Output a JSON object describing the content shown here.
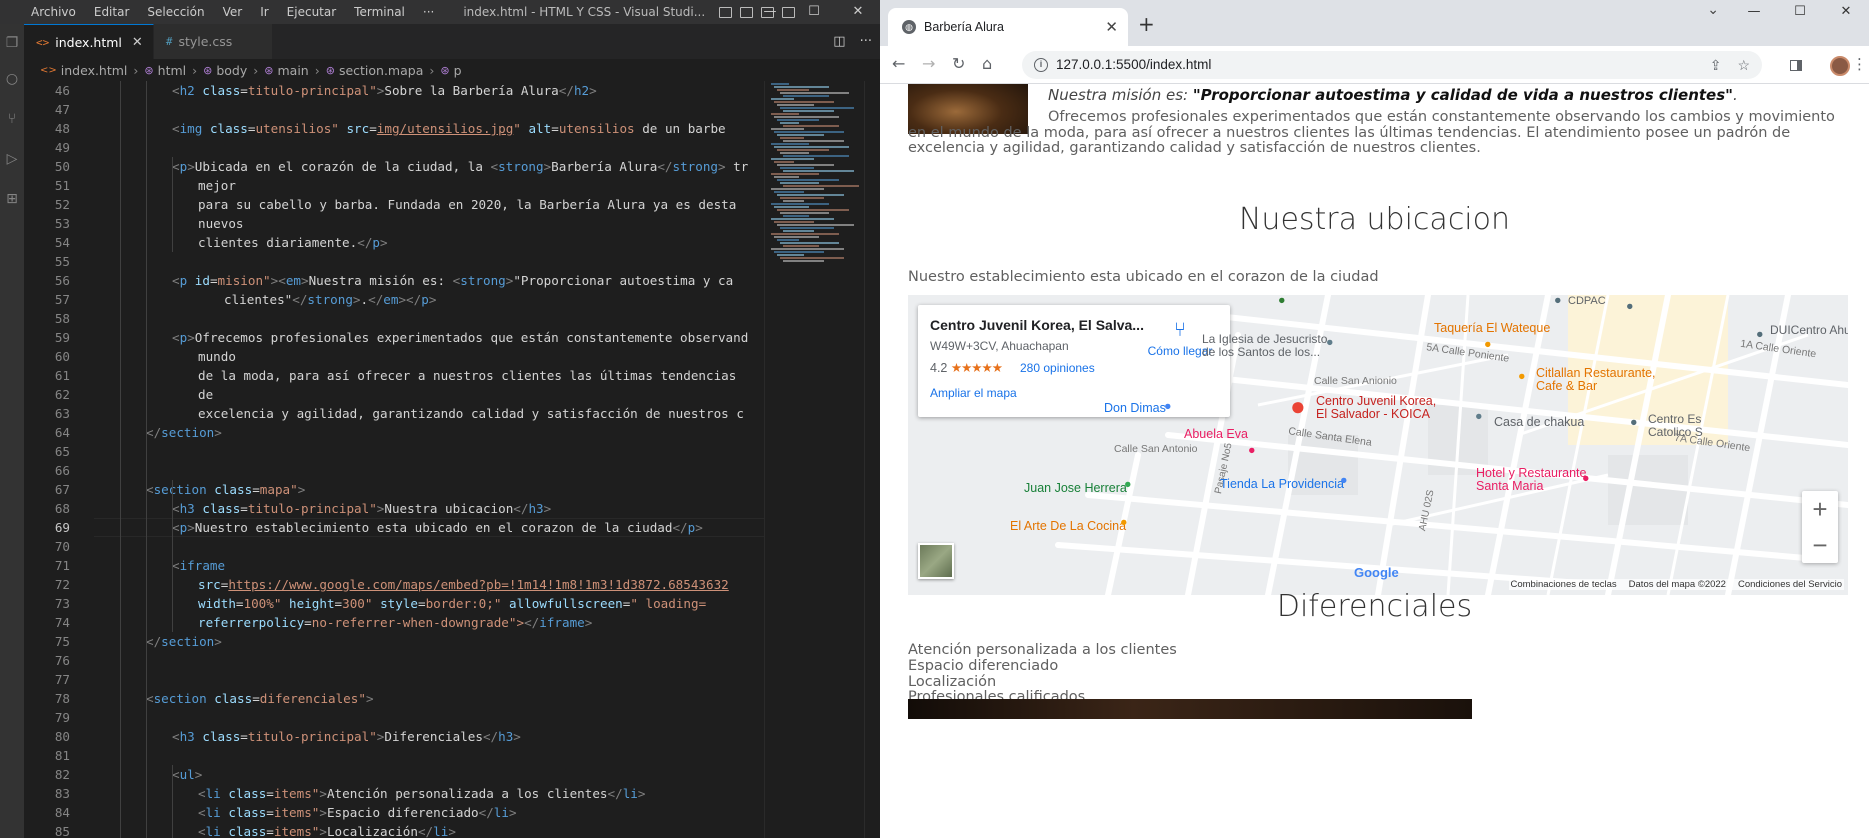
{
  "vscode": {
    "menu": [
      "Archivo",
      "Editar",
      "Selección",
      "Ver",
      "Ir",
      "Ejecutar",
      "Terminal",
      "···"
    ],
    "window_title": "index.html - HTML Y CSS - Visual Studi...",
    "tabs": [
      {
        "label": "index.html",
        "icon": "html-icon",
        "active": true
      },
      {
        "label": "style.css",
        "icon": "css-icon",
        "active": false
      }
    ],
    "breadcrumb": [
      "index.html",
      "html",
      "body",
      "main",
      "section.mapa",
      "p"
    ],
    "current_line": 69,
    "line_numbers": [
      "46",
      "47",
      "48",
      "49",
      "50",
      "51",
      "52",
      "53",
      "54",
      "55",
      "56",
      "57",
      "58",
      "59",
      "60",
      "61",
      "62",
      "63",
      "64",
      "65",
      "66",
      "67",
      "68",
      "69",
      "70",
      "71",
      "72",
      "73",
      "74",
      "75",
      "76",
      "77",
      "78",
      "79",
      "80",
      "81",
      "82",
      "83",
      "84",
      "85"
    ],
    "code": [
      "<h2 class=\"titulo-principal\">Sobre la Barbería Alura</h2>",
      "",
      "<img class=\"utensilios\" src=\"img/utensilios.jpg\" alt=\"utensilios de un barbe",
      "",
      "<p>Ubicada en el corazón de la ciudad, la <strong>Barbería Alura</strong> tr",
      "mejor",
      "para su cabello y barba. Fundada en 2020, la Barbería Alura ya es desta",
      "nuevos",
      "clientes diariamente.</p>",
      "",
      "<p id=\"mision\"><em>Nuestra misión es: <strong>\"Proporcionar autoestima y ca",
      "clientes\"</strong>.</em></p>",
      "",
      "<p>Ofrecemos profesionales experimentados que están constantemente observand",
      "mundo",
      "de la moda, para así ofrecer a nuestros clientes las últimas tendencias",
      "de",
      "excelencia y agilidad, garantizando calidad y satisfacción de nuestros c",
      "</section>",
      "",
      "",
      "<section class=\"mapa\">",
      "<h3 class=\"titulo-principal\">Nuestra ubicacion</h3>",
      "<p>Nuestro establecimiento esta ubicado en el corazon de la ciudad</p>",
      "",
      "<iframe",
      "src=\"https://www.google.com/maps/embed?pb=!1m14!1m8!1m3!1d3872.68543632",
      "width=\"100%\" height=\"300\" style=\"border:0;\" allowfullscreen=\"\" loading=",
      "referrerpolicy=\"no-referrer-when-downgrade\"></iframe>",
      "</section>",
      "",
      "",
      "<section class=\"diferenciales\">",
      "",
      "<h3 class=\"titulo-principal\">Diferenciales</h3>",
      "",
      "<ul>",
      "<li class=\"items\">Atención personalizada a los clientes</li>",
      "<li class=\"items\">Espacio diferenciado</li>",
      "<li class=\"items\">Localización</li>"
    ]
  },
  "chrome": {
    "tab_title": "Barbería Alura",
    "url": "127.0.0.1:5500/index.html",
    "page": {
      "mision_label": "Nuestra misión es: ",
      "mision_quote": "\"Proporcionar autoestima y calidad de vida a nuestros clientes\"",
      "mision_end": ".",
      "ofrecemos": "Ofrecemos profesionales experimentados que están constantemente observando los cambios y movimiento en el mundo de la moda, para así ofrecer a nuestros clientes las últimas tendencias. El atendimiento posee un padrón de excelencia y agilidad, garantizando calidad y satisfacción de nuestros clientes.",
      "ubicacion_title": "Nuestra ubicacion",
      "ubicacion_text": "Nuestro establecimiento esta ubicado en el corazon de la ciudad",
      "map": {
        "place_name": "Centro Juvenil Korea, El Salva...",
        "address": "W49W+3CV, Ahuachapan",
        "rating": "4.2",
        "stars": "★★★★★",
        "reviews": "280 opiniones",
        "directions": "Cómo llegar",
        "enlarge": "Ampliar el mapa",
        "marker_label_1": "Centro Juvenil Korea,",
        "marker_label_2": "El Salvador - KOICA",
        "pois": {
          "cdpac": "CDPAC",
          "iglesia_1": "La Iglesia de Jesucristo",
          "iglesia_2": "de los Santos de los...",
          "taqueria": "Taquería El Wateque",
          "duicentro": "DUICentro Ahua",
          "calle_poniente": "5A Calle Poniente",
          "calle_oriente_1": "1A Calle Oriente",
          "calle_san_antonio_1": "Calle San Anionio",
          "citlallan_1": "Citlallan Restaurante,",
          "citlallan_2": "Cafe & Bar",
          "don_dimas": "Don Dimas",
          "abuela_eva": "Abuela Eva",
          "calle_santa_elena": "Calle Santa Elena",
          "casa_chakua": "Casa de chakua",
          "centro_es_1": "Centro Es",
          "centro_es_2": "Catolico S",
          "calle_oriente_7": "7A Calle Oriente",
          "calle_san_antonio_2": "Calle San Antonio",
          "pasaje": "Pasaje No5",
          "juan_jose": "Juan Jose Herrera",
          "tienda": "Tienda La Providencia",
          "ahu": "AHU 02S",
          "hotel_1": "Hotel y Restaurante",
          "hotel_2": "Santa Maria",
          "arte": "El Arte De La Cocina"
        },
        "google": "Google",
        "zoom_in": "+",
        "zoom_out": "−",
        "footer": [
          "Combinaciones de teclas",
          "Datos del mapa ©2022",
          "Condiciones del Servicio"
        ]
      },
      "diferenciales_title": "Diferenciales",
      "diferenciales": [
        "Atención personalizada a los clientes",
        "Espacio diferenciado",
        "Localización",
        "Profesionales calificados"
      ]
    }
  },
  "colors": {
    "vscode_bg": "#1e1e1e",
    "tag": "#569cd6",
    "attr": "#9cdcfe",
    "string": "#ce9178",
    "text": "#d4d4d4",
    "marker_red": "#ea4335",
    "link_blue": "#1a73e8"
  }
}
